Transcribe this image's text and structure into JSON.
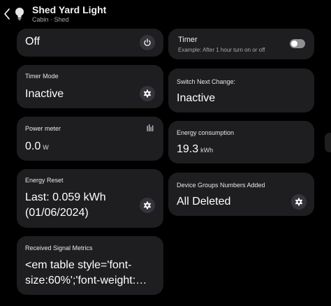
{
  "header": {
    "title": "Shed Yard Light",
    "subtitle": "Cabin · Shed"
  },
  "cards": {
    "power": {
      "value": "Off"
    },
    "timer": {
      "label": "Timer",
      "hint": "Example: After 1 hour turn on or off",
      "enabled": false
    },
    "timer_mode": {
      "label": "Timer Mode",
      "value": "Inactive"
    },
    "switch_next_change": {
      "label": "Switch Next Change:",
      "value": "Inactive"
    },
    "power_meter": {
      "label": "Power meter",
      "value": "0.0",
      "unit": "W"
    },
    "energy_consumption": {
      "label": "Energy consumption",
      "value": "19.3",
      "unit": "kWh"
    },
    "energy_reset": {
      "label": "Energy Reset",
      "line1": "Last: 0.059 kWh",
      "line2": "(01/06/2024)"
    },
    "device_groups": {
      "label": "Device Groups Numbers Added",
      "value": "All Deleted"
    },
    "signal_metrics": {
      "label": "Received Signal Metrics",
      "line1": "<em table style='font-",
      "line2": "size:60%';'font-weight:…"
    }
  },
  "icons": {
    "back": "chevron-left-icon",
    "device": "light-bulb-icon",
    "power": "power-icon",
    "settings": "gear-icon",
    "chart": "bar-chart-icon"
  },
  "colors": {
    "background": "#000000",
    "card": "#1e1e21",
    "button": "#34343a",
    "toggle_off": "#8e8e93",
    "muted_text": "#a9a9ad"
  }
}
